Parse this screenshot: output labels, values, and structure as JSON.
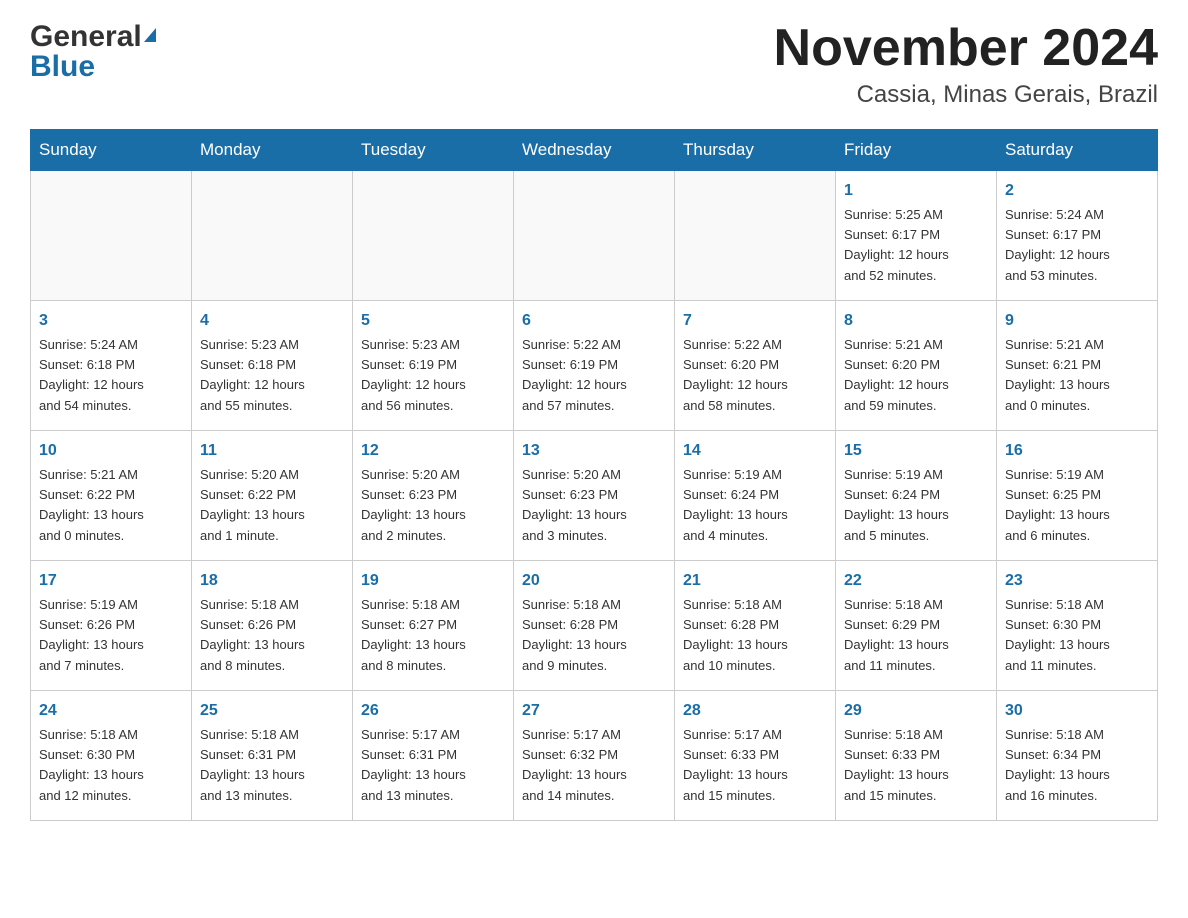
{
  "header": {
    "logo_general": "General",
    "logo_blue": "Blue",
    "month_title": "November 2024",
    "location": "Cassia, Minas Gerais, Brazil"
  },
  "weekdays": [
    "Sunday",
    "Monday",
    "Tuesday",
    "Wednesday",
    "Thursday",
    "Friday",
    "Saturday"
  ],
  "weeks": [
    [
      {
        "day": "",
        "info": ""
      },
      {
        "day": "",
        "info": ""
      },
      {
        "day": "",
        "info": ""
      },
      {
        "day": "",
        "info": ""
      },
      {
        "day": "",
        "info": ""
      },
      {
        "day": "1",
        "info": "Sunrise: 5:25 AM\nSunset: 6:17 PM\nDaylight: 12 hours\nand 52 minutes."
      },
      {
        "day": "2",
        "info": "Sunrise: 5:24 AM\nSunset: 6:17 PM\nDaylight: 12 hours\nand 53 minutes."
      }
    ],
    [
      {
        "day": "3",
        "info": "Sunrise: 5:24 AM\nSunset: 6:18 PM\nDaylight: 12 hours\nand 54 minutes."
      },
      {
        "day": "4",
        "info": "Sunrise: 5:23 AM\nSunset: 6:18 PM\nDaylight: 12 hours\nand 55 minutes."
      },
      {
        "day": "5",
        "info": "Sunrise: 5:23 AM\nSunset: 6:19 PM\nDaylight: 12 hours\nand 56 minutes."
      },
      {
        "day": "6",
        "info": "Sunrise: 5:22 AM\nSunset: 6:19 PM\nDaylight: 12 hours\nand 57 minutes."
      },
      {
        "day": "7",
        "info": "Sunrise: 5:22 AM\nSunset: 6:20 PM\nDaylight: 12 hours\nand 58 minutes."
      },
      {
        "day": "8",
        "info": "Sunrise: 5:21 AM\nSunset: 6:20 PM\nDaylight: 12 hours\nand 59 minutes."
      },
      {
        "day": "9",
        "info": "Sunrise: 5:21 AM\nSunset: 6:21 PM\nDaylight: 13 hours\nand 0 minutes."
      }
    ],
    [
      {
        "day": "10",
        "info": "Sunrise: 5:21 AM\nSunset: 6:22 PM\nDaylight: 13 hours\nand 0 minutes."
      },
      {
        "day": "11",
        "info": "Sunrise: 5:20 AM\nSunset: 6:22 PM\nDaylight: 13 hours\nand 1 minute."
      },
      {
        "day": "12",
        "info": "Sunrise: 5:20 AM\nSunset: 6:23 PM\nDaylight: 13 hours\nand 2 minutes."
      },
      {
        "day": "13",
        "info": "Sunrise: 5:20 AM\nSunset: 6:23 PM\nDaylight: 13 hours\nand 3 minutes."
      },
      {
        "day": "14",
        "info": "Sunrise: 5:19 AM\nSunset: 6:24 PM\nDaylight: 13 hours\nand 4 minutes."
      },
      {
        "day": "15",
        "info": "Sunrise: 5:19 AM\nSunset: 6:24 PM\nDaylight: 13 hours\nand 5 minutes."
      },
      {
        "day": "16",
        "info": "Sunrise: 5:19 AM\nSunset: 6:25 PM\nDaylight: 13 hours\nand 6 minutes."
      }
    ],
    [
      {
        "day": "17",
        "info": "Sunrise: 5:19 AM\nSunset: 6:26 PM\nDaylight: 13 hours\nand 7 minutes."
      },
      {
        "day": "18",
        "info": "Sunrise: 5:18 AM\nSunset: 6:26 PM\nDaylight: 13 hours\nand 8 minutes."
      },
      {
        "day": "19",
        "info": "Sunrise: 5:18 AM\nSunset: 6:27 PM\nDaylight: 13 hours\nand 8 minutes."
      },
      {
        "day": "20",
        "info": "Sunrise: 5:18 AM\nSunset: 6:28 PM\nDaylight: 13 hours\nand 9 minutes."
      },
      {
        "day": "21",
        "info": "Sunrise: 5:18 AM\nSunset: 6:28 PM\nDaylight: 13 hours\nand 10 minutes."
      },
      {
        "day": "22",
        "info": "Sunrise: 5:18 AM\nSunset: 6:29 PM\nDaylight: 13 hours\nand 11 minutes."
      },
      {
        "day": "23",
        "info": "Sunrise: 5:18 AM\nSunset: 6:30 PM\nDaylight: 13 hours\nand 11 minutes."
      }
    ],
    [
      {
        "day": "24",
        "info": "Sunrise: 5:18 AM\nSunset: 6:30 PM\nDaylight: 13 hours\nand 12 minutes."
      },
      {
        "day": "25",
        "info": "Sunrise: 5:18 AM\nSunset: 6:31 PM\nDaylight: 13 hours\nand 13 minutes."
      },
      {
        "day": "26",
        "info": "Sunrise: 5:17 AM\nSunset: 6:31 PM\nDaylight: 13 hours\nand 13 minutes."
      },
      {
        "day": "27",
        "info": "Sunrise: 5:17 AM\nSunset: 6:32 PM\nDaylight: 13 hours\nand 14 minutes."
      },
      {
        "day": "28",
        "info": "Sunrise: 5:17 AM\nSunset: 6:33 PM\nDaylight: 13 hours\nand 15 minutes."
      },
      {
        "day": "29",
        "info": "Sunrise: 5:18 AM\nSunset: 6:33 PM\nDaylight: 13 hours\nand 15 minutes."
      },
      {
        "day": "30",
        "info": "Sunrise: 5:18 AM\nSunset: 6:34 PM\nDaylight: 13 hours\nand 16 minutes."
      }
    ]
  ]
}
